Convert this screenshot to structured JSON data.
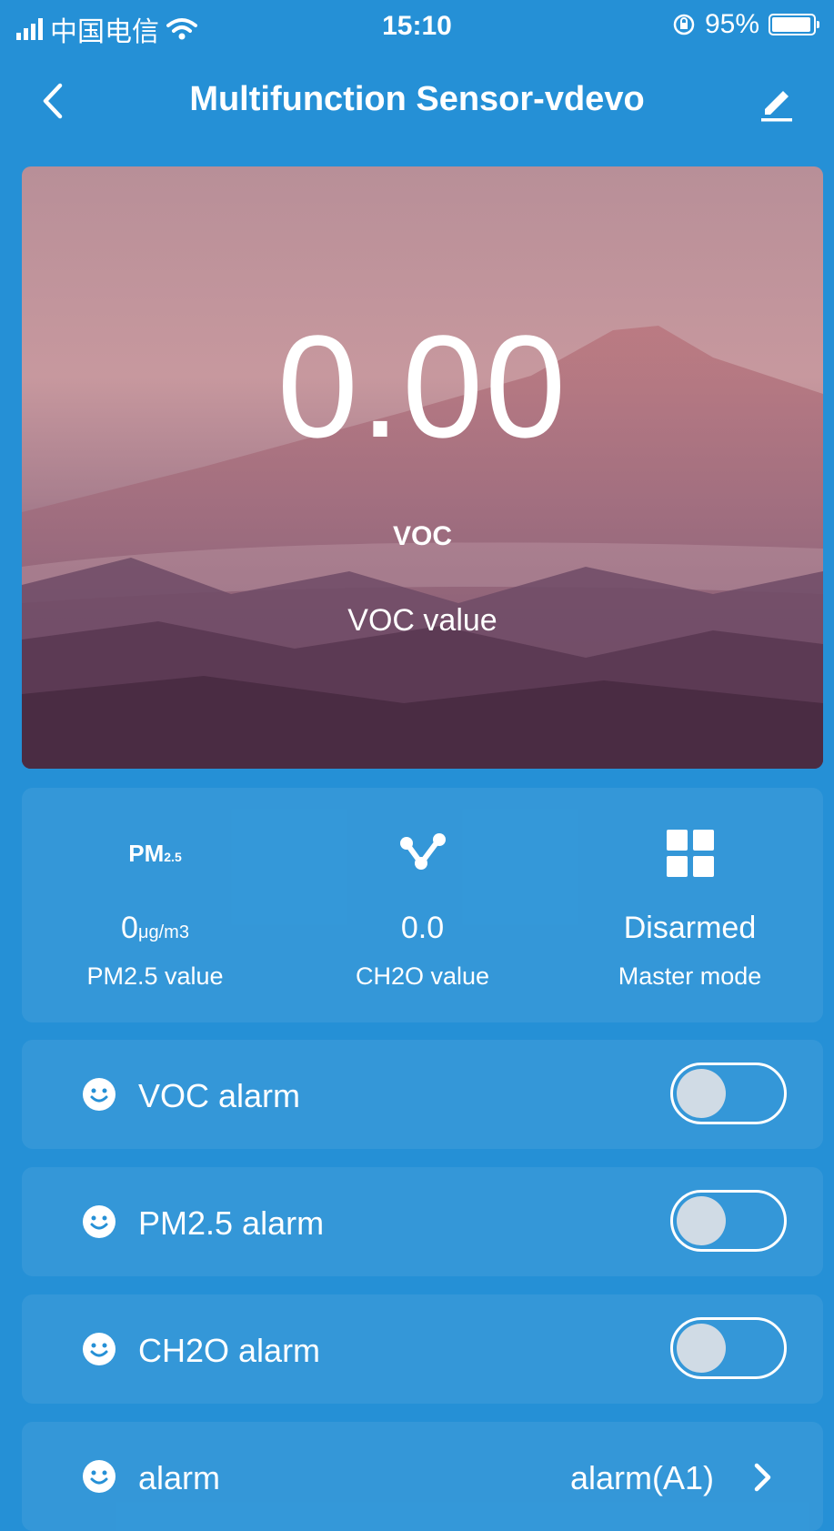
{
  "status_bar": {
    "carrier": "中国电信",
    "time": "15:10",
    "battery": "95%",
    "battery_level": 0.95
  },
  "nav": {
    "title": "Multifunction Sensor-vdevo",
    "back_icon": "chevron-left-icon",
    "edit_icon": "pencil-icon"
  },
  "hero": {
    "value": "0.00",
    "unit": "VOC",
    "label": "VOC value"
  },
  "stats": [
    {
      "icon": "pm25-icon",
      "icon_text": "PM",
      "icon_sub": "2.5",
      "value": "0",
      "unit": "μg/m3",
      "label": "PM2.5 value"
    },
    {
      "icon": "molecule-icon",
      "value": "0.0",
      "unit": "",
      "label": "CH2O value"
    },
    {
      "icon": "grid-icon",
      "value": "Disarmed",
      "unit": "",
      "label": "Master mode"
    }
  ],
  "rows": [
    {
      "icon": "smiley-icon",
      "label": "VOC alarm",
      "toggle_on": false
    },
    {
      "icon": "smiley-icon",
      "label": "PM2.5 alarm",
      "toggle_on": false
    },
    {
      "icon": "smiley-icon",
      "label": "CH2O alarm",
      "toggle_on": false
    },
    {
      "icon": "smiley-icon",
      "label": "alarm",
      "value": "alarm(A1)"
    }
  ],
  "colors": {
    "background": "#2590d6",
    "knob": "#d0dbe5"
  }
}
